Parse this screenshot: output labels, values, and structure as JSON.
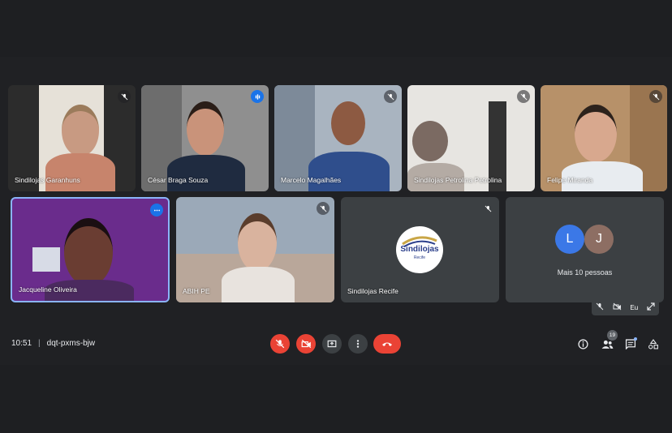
{
  "meeting": {
    "time": "10:51",
    "separator": "|",
    "code": "dqt-pxms-bjw"
  },
  "participants": [
    {
      "name": "Sindilojas Garanhuns",
      "status": "muted"
    },
    {
      "name": "César Braga Souza",
      "status": "speaking"
    },
    {
      "name": "Marcelo Magalhães",
      "status": "muted"
    },
    {
      "name": "Sindilojas Petrolina Petrolina",
      "status": "muted"
    },
    {
      "name": "Felipe Miranda",
      "status": "muted"
    },
    {
      "name": "Jacqueline Oliveira",
      "status": "menu"
    },
    {
      "name": "ABIH PE",
      "status": "muted"
    },
    {
      "name": "Sindilojas Recife",
      "status": "muted",
      "logo_text": "Sindilojas",
      "logo_subtext": "Recife"
    }
  ],
  "others": {
    "label": "Mais 10 pessoas",
    "avatars": [
      {
        "letter": "L",
        "color": "#3b78e7"
      },
      {
        "letter": "J",
        "color": "#8d6e63"
      }
    ]
  },
  "self_view": {
    "label": "Eu"
  },
  "controls": {
    "participants_count": "19",
    "colors": {
      "danger": "#ea4335",
      "neutral": "#3c4043",
      "accent": "#8ab4f8"
    }
  }
}
